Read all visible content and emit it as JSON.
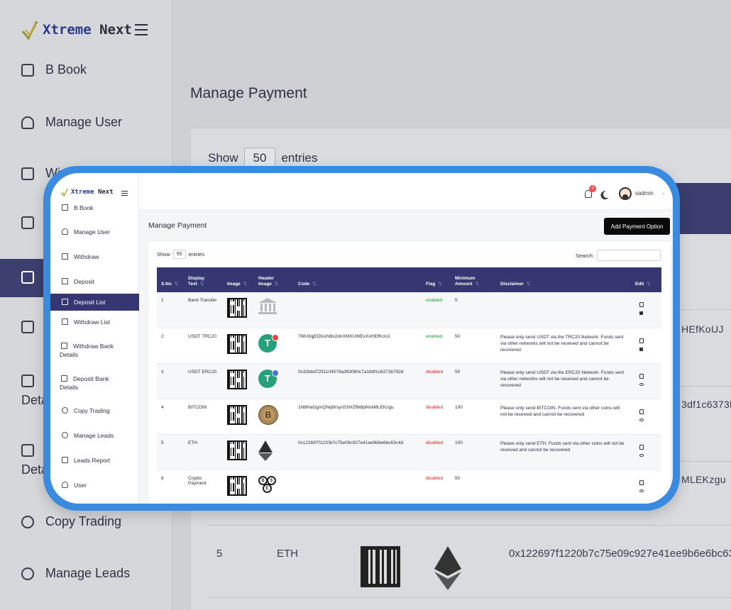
{
  "brand": {
    "name_part1": "Xtreme",
    "name_part2": "Next"
  },
  "background": {
    "page_title": "Manage Payment",
    "show_label": "Show",
    "show_value": "50",
    "entries_label": "entries",
    "nav": [
      "B Book",
      "Manage User",
      "Wi",
      "Deta",
      "Deta",
      "Copy Trading",
      "Manage Leads"
    ],
    "fragments": [
      "HEfKoUJ",
      "3df1c6373b",
      "MLEKzgu"
    ],
    "row5": {
      "sno": "5",
      "text": "ETH",
      "code": "0x122697f1220b7c75e09c927e41ee9b6e6bc63"
    }
  },
  "header": {
    "notifications_count": "0",
    "username": "sadmin"
  },
  "sidebar": {
    "items": [
      {
        "label": "B Book",
        "icon": "book-icon"
      },
      {
        "label": "Manage User",
        "icon": "users-icon"
      },
      {
        "label": "Withdraw",
        "icon": "archive-icon"
      },
      {
        "label": "Deposit",
        "icon": "archive-icon"
      },
      {
        "label": "Deposit List",
        "icon": "archive-icon",
        "active": true
      },
      {
        "label": "Withdraw List",
        "icon": "archive-icon"
      },
      {
        "label": "Withdraw Bank",
        "label2": "Details",
        "icon": "archive-icon"
      },
      {
        "label": "Deposit Bank",
        "label2": "Details",
        "icon": "archive-icon"
      },
      {
        "label": "Copy Trading",
        "icon": "user-plus-icon"
      },
      {
        "label": "Manage Leads",
        "icon": "check-circle-icon"
      },
      {
        "label": "Leads Report",
        "icon": "file-icon"
      },
      {
        "label": "User",
        "icon": "user-icon"
      }
    ]
  },
  "main": {
    "title": "Manage Payment",
    "add_button": "Add Payment Option",
    "show_label": "Show",
    "show_value": "50",
    "entries_label": "entries",
    "search_label": "Search:",
    "search_value": ""
  },
  "table": {
    "columns": [
      "S.No",
      "Display Text",
      "Image",
      "Header Image",
      "Code",
      "Flag",
      "Minimum Amount",
      "Disclaimer",
      "Edit"
    ],
    "rows": [
      {
        "sno": "1",
        "text": "Bank Transfer",
        "header_icon": "bank-icon",
        "code": "",
        "flag": "enabled",
        "min": "5",
        "disclaimer": "",
        "actions": [
          "edit",
          "trash"
        ]
      },
      {
        "sno": "2",
        "text": "USDT TRC20",
        "header_icon": "tether-trc20-icon",
        "code": "TMUitqjEDtLkN8x2dnXMXUWExXoHEfKoUJ",
        "flag": "enabled",
        "min": "50",
        "disclaimer": "Please only send USDT via the TRC20 Network. Funds sent via other networks will not be received and cannot be recovered",
        "actions": [
          "edit",
          "trash"
        ]
      },
      {
        "sno": "3",
        "text": "USDT ERC20",
        "header_icon": "tether-erc20-icon",
        "code": "0x32bbd7251104578a393060c7a18df1c6373b792d",
        "flag": "disabled",
        "min": "50",
        "disclaimer": "Please only send USDT via the ERC20 Network. Funds sent via other networks will not be received and cannot be recovered",
        "actions": [
          "edit",
          "view"
        ]
      },
      {
        "sno": "4",
        "text": "BITCOIN",
        "header_icon": "bitcoin-icon",
        "code": "1N8HaGgmQNqWsyrGSHZf6t8pNmiMLEKzgu",
        "flag": "disabled",
        "min": "100",
        "disclaimer": "Please only send BITCOIN. Funds sent via other coins will not be received and cannot be recovered",
        "actions": [
          "edit",
          "view"
        ]
      },
      {
        "sno": "5",
        "text": "ETH",
        "header_icon": "ethereum-icon",
        "code": "0x122697f1220b7c75e09c927e41ee9b6e6bc63c4d",
        "flag": "disabled",
        "min": "100",
        "disclaimer": "Please only send ETH. Funds sent via other coins will not be received and cannot be recovered",
        "actions": [
          "edit",
          "view"
        ]
      },
      {
        "sno": "6",
        "text": "Crypto Payment",
        "header_icon": "crypto-coins-icon",
        "code": "",
        "flag": "disabled",
        "min": "50",
        "disclaimer": "",
        "actions": [
          "edit",
          "view"
        ]
      }
    ]
  },
  "colors": {
    "primary": "#353672",
    "enabled": "#1a9a33",
    "disabled": "#e02020",
    "frame": "#3a8be0"
  }
}
